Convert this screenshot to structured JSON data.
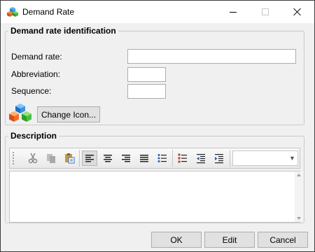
{
  "window": {
    "title": "Demand Rate",
    "icon": "cubes-icon",
    "controls": [
      "minimize-icon",
      "maximize-icon",
      "close-icon"
    ]
  },
  "identification": {
    "legend": "Demand rate identification",
    "demand_rate_label": "Demand rate:",
    "demand_rate_value": "",
    "abbreviation_label": "Abbreviation:",
    "abbreviation_value": "",
    "sequence_label": "Sequence:",
    "sequence_value": "",
    "rate_icon": "colored-cubes-icon",
    "change_icon_label": "Change Icon..."
  },
  "description": {
    "legend": "Description",
    "toolbar_icons": [
      "cut-icon",
      "copy-icon",
      "paste-icon",
      "align-left-icon",
      "align-center-icon",
      "align-right-icon",
      "justify-icon",
      "bullet-list-icon",
      "numbered-list-icon",
      "outdent-icon",
      "indent-icon"
    ],
    "selected_alignment": "align-left-icon",
    "style_value": "",
    "text": ""
  },
  "footer": {
    "ok_label": "OK",
    "edit_label": "Edit",
    "cancel_label": "Cancel"
  }
}
